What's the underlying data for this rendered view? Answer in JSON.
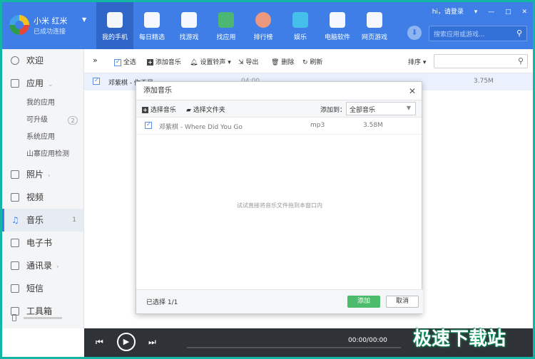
{
  "header": {
    "device_name": "小米 红米",
    "device_status": "已成功连接",
    "nav": [
      {
        "label": "我的手机",
        "icon": "phone-icon"
      },
      {
        "label": "每日精选",
        "icon": "calendar-star-icon"
      },
      {
        "label": "找游戏",
        "icon": "gamepad-icon"
      },
      {
        "label": "找应用",
        "icon": "shopping-bag-icon"
      },
      {
        "label": "排行榜",
        "icon": "medal-icon"
      },
      {
        "label": "娱乐",
        "icon": "entertainment-icon"
      },
      {
        "label": "电脑软件",
        "icon": "monitor-icon"
      },
      {
        "label": "网页游戏",
        "icon": "web-game-icon"
      }
    ],
    "login_text": "hi，请登录",
    "search_placeholder": "搜索应用或游戏..."
  },
  "sidebar": {
    "items": [
      {
        "label": "欢迎",
        "icon": "welcome-icon"
      },
      {
        "label": "应用",
        "icon": "apps-grid-icon"
      },
      {
        "label": "照片",
        "icon": "photo-icon"
      },
      {
        "label": "视频",
        "icon": "video-icon"
      },
      {
        "label": "音乐",
        "icon": "music-note-icon",
        "count": "1"
      },
      {
        "label": "电子书",
        "icon": "book-icon"
      },
      {
        "label": "通讯录",
        "icon": "contacts-icon"
      },
      {
        "label": "短信",
        "icon": "sms-icon"
      },
      {
        "label": "工具箱",
        "icon": "toolbox-icon"
      }
    ],
    "app_subitems": [
      "我的应用",
      "可升级",
      "系统应用",
      "山寨应用检测"
    ],
    "upgrade_count": "2"
  },
  "toolbar": {
    "select_all": "全选",
    "add_music": "添加音乐",
    "set_ringtone": "设置铃声",
    "export": "导出",
    "delete": "删除",
    "refresh": "刷新",
    "sort": "排序"
  },
  "music_list": [
    {
      "name": "邓紫棋 - 你不是...",
      "duration": "04:00",
      "size": "3.75M"
    }
  ],
  "dialog": {
    "title": "添加音乐",
    "select_music": "选择音乐",
    "select_folder": "选择文件夹",
    "add_to_label": "添加到：",
    "add_to_value": "全部音乐",
    "files": [
      {
        "name": "邓紫棋 - Where Did You Go",
        "format": "mp3",
        "size": "3.58M"
      }
    ],
    "hint": "试试直接将音乐文件拖到本窗口内",
    "selected": "已选择 1/1",
    "add_button": "添加",
    "cancel_button": "取消"
  },
  "player": {
    "time": "00:00/00:00"
  },
  "watermark": "极速下载站"
}
